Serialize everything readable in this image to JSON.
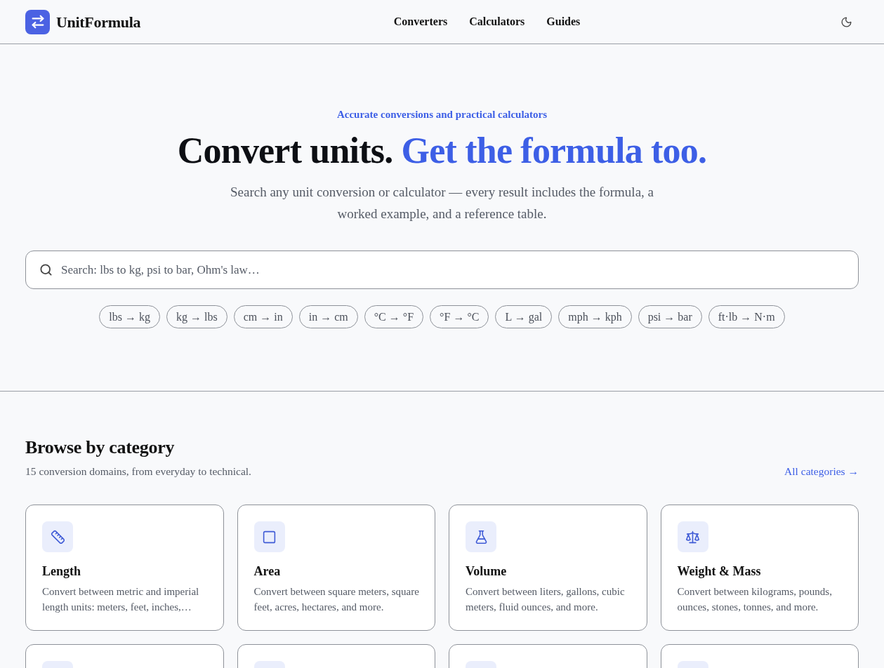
{
  "header": {
    "logo": "UnitFormula",
    "nav": [
      "Converters",
      "Calculators",
      "Guides"
    ]
  },
  "hero": {
    "eyebrow": "Accurate conversions and practical calculators",
    "title_start": "Convert units.",
    "title_highlight": "Get the formula too.",
    "subtitle": "Search any unit conversion or calculator — every result includes the formula, a worked example, and a reference table.",
    "search": {
      "placeholder": "Search: lbs to kg, psi to bar, Ohm's law…"
    },
    "chips": [
      "lbs → kg",
      "kg → lbs",
      "cm → in",
      "in → cm",
      "°C → °F",
      "°F → °C",
      "L → gal",
      "mph → kph",
      "psi → bar",
      "ft·lb → N·m"
    ]
  },
  "categories": {
    "title": "Browse by category",
    "subtitle": "15 conversion domains, from everyday to technical.",
    "link": "All categories →",
    "cards": [
      {
        "kind": "full",
        "title": "Length",
        "description": "Convert between metric and imperial length units: meters, feet, inches,…"
      },
      {
        "kind": "full",
        "title": "Area",
        "description": "Convert between square meters, square feet, acres, hectares, and more."
      },
      {
        "kind": "full",
        "title": "Volume",
        "description": "Convert between liters, gallons, cubic meters, fluid ounces, and more."
      },
      {
        "kind": "full",
        "title": "Weight & Mass",
        "description": "Convert between kilograms, pounds, ounces, stones, tonnes, and more."
      },
      {
        "kind": "cut_off"
      },
      {
        "kind": "cut_off"
      },
      {
        "kind": "cut_off"
      },
      {
        "kind": "cut_off"
      }
    ]
  }
}
